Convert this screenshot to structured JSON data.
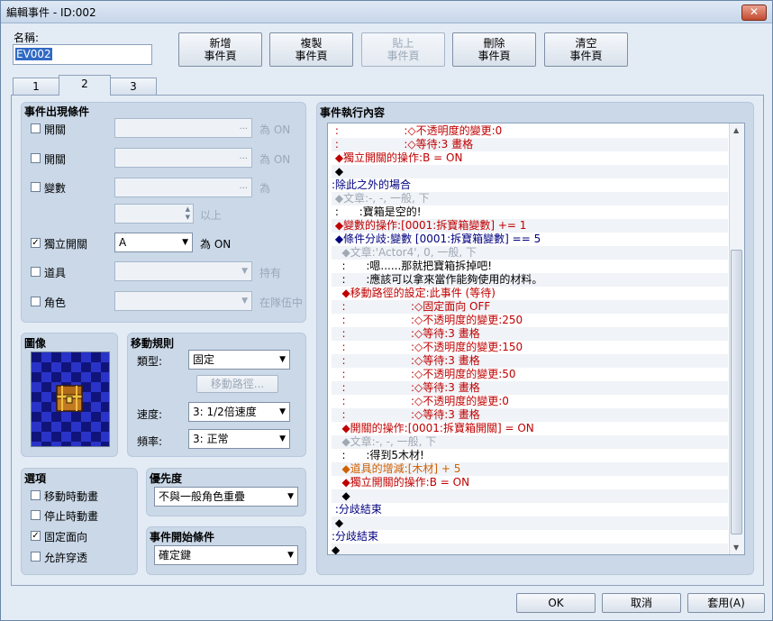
{
  "window": {
    "title": "編輯事件 - ID:002",
    "close_label": "✕"
  },
  "name_field": {
    "label": "名稱:",
    "value": "EV002"
  },
  "page_buttons": {
    "new": [
      "新增",
      "事件頁"
    ],
    "copy": [
      "複製",
      "事件頁"
    ],
    "paste": [
      "貼上",
      "事件頁"
    ],
    "delete": [
      "刪除",
      "事件頁"
    ],
    "clear": [
      "清空",
      "事件頁"
    ]
  },
  "tabs": [
    "1",
    "2",
    "3"
  ],
  "active_tab": "2",
  "conditions": {
    "title": "事件出現條件",
    "switch1": {
      "label": "開關",
      "checked": false,
      "suffix": "為 ON"
    },
    "switch2": {
      "label": "開關",
      "checked": false,
      "suffix": "為 ON"
    },
    "variable": {
      "label": "變數",
      "checked": false,
      "suffix": "為",
      "suffix2": "以上"
    },
    "self_switch": {
      "label": "獨立開關",
      "checked": true,
      "value": "A",
      "suffix": "為 ON"
    },
    "item": {
      "label": "道具",
      "checked": false,
      "suffix": "持有"
    },
    "actor": {
      "label": "角色",
      "checked": false,
      "suffix": "在隊伍中"
    },
    "dots": "..."
  },
  "image": {
    "title": "圖像"
  },
  "movement": {
    "title": "移動規則",
    "type_label": "類型:",
    "type_value": "固定",
    "route_button": "移動路徑...",
    "speed_label": "速度:",
    "speed_value": "3: 1/2倍速度",
    "freq_label": "頻率:",
    "freq_value": "3: 正常"
  },
  "options": {
    "title": "選項",
    "walking": {
      "label": "移動時動畫",
      "checked": false
    },
    "stepping": {
      "label": "停止時動畫",
      "checked": false
    },
    "direction_fix": {
      "label": "固定面向",
      "checked": true
    },
    "through": {
      "label": "允許穿透",
      "checked": false
    }
  },
  "priority": {
    "title": "優先度",
    "value": "不與一般角色重疊"
  },
  "trigger": {
    "title": "事件開始條件",
    "value": "確定鍵"
  },
  "contents": {
    "title": "事件執行內容",
    "lines": [
      {
        "text": " :                   :◇不透明度的變更:0",
        "color": "red"
      },
      {
        "text": " :                   :◇等待:3 畫格",
        "color": "red"
      },
      {
        "text": " ◆獨立開關的操作:B = ON",
        "color": "red"
      },
      {
        "text": " ◆",
        "color": ""
      },
      {
        "text": ":除此之外的場合",
        "color": "blue"
      },
      {
        "text": " ◆文章:-, -, 一般, 下",
        "color": "gray"
      },
      {
        "text": " :      :寶箱是空的!",
        "color": ""
      },
      {
        "text": " ◆變數的操作:[0001:拆寶箱變數] += 1",
        "color": "red"
      },
      {
        "text": " ◆條件分歧:變數 [0001:拆寶箱變數] == 5",
        "color": "blue"
      },
      {
        "text": "   ◆文章:'Actor4', 0, 一般, 下",
        "color": "gray"
      },
      {
        "text": "   :      :嗯......那就把寶箱拆掉吧!",
        "color": ""
      },
      {
        "text": "   :      :應該可以拿來當作能夠使用的材料。",
        "color": ""
      },
      {
        "text": "   ◆移動路徑的設定:此事件 (等待)",
        "color": "red"
      },
      {
        "text": "   :                   :◇固定面向 OFF",
        "color": "red"
      },
      {
        "text": "   :                   :◇不透明度的變更:250",
        "color": "red"
      },
      {
        "text": "   :                   :◇等待:3 畫格",
        "color": "red"
      },
      {
        "text": "   :                   :◇不透明度的變更:150",
        "color": "red"
      },
      {
        "text": "   :                   :◇等待:3 畫格",
        "color": "red"
      },
      {
        "text": "   :                   :◇不透明度的變更:50",
        "color": "red"
      },
      {
        "text": "   :                   :◇等待:3 畫格",
        "color": "red"
      },
      {
        "text": "   :                   :◇不透明度的變更:0",
        "color": "red"
      },
      {
        "text": "   :                   :◇等待:3 畫格",
        "color": "red"
      },
      {
        "text": "   ◆開關的操作:[0001:拆寶箱開關] = ON",
        "color": "red"
      },
      {
        "text": "   ◆文章:-, -, 一般, 下",
        "color": "gray"
      },
      {
        "text": "   :      :得到5木材!",
        "color": ""
      },
      {
        "text": "   ◆道具的增減:[木材] + 5",
        "color": "orange"
      },
      {
        "text": "   ◆獨立開關的操作:B = ON",
        "color": "red"
      },
      {
        "text": "   ◆",
        "color": ""
      },
      {
        "text": " :分歧結束",
        "color": "blue"
      },
      {
        "text": " ◆",
        "color": ""
      },
      {
        "text": ":分歧結束",
        "color": "blue"
      },
      {
        "text": "◆",
        "color": ""
      }
    ]
  },
  "footer": {
    "ok": "OK",
    "cancel": "取消",
    "apply": "套用(A)"
  }
}
